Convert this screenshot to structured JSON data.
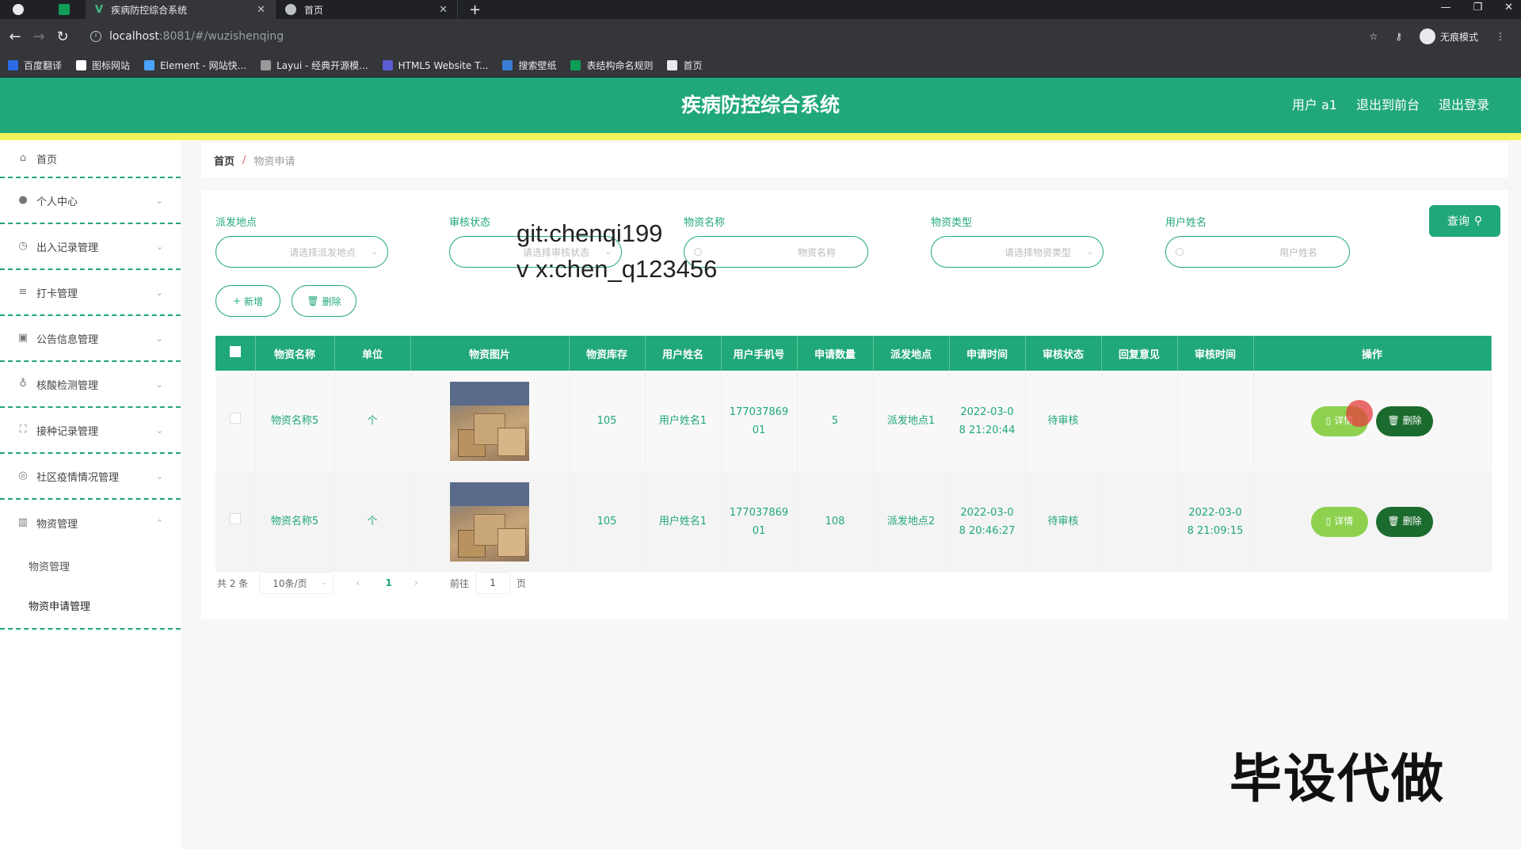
{
  "browser": {
    "tabs": [
      {
        "label": "疾病防控综合系统",
        "active": true
      },
      {
        "label": "首页",
        "active": false
      }
    ],
    "url_host": "localhost",
    "url_path": ":8081/#/wuzishenqing",
    "incognito_label": "无痕模式",
    "bookmarks": [
      {
        "label": "百度翻译",
        "color": "#2d6be4"
      },
      {
        "label": "图标网站",
        "color": "#ffffff"
      },
      {
        "label": "Element - 网站快...",
        "color": "#4aa3ff"
      },
      {
        "label": "Layui - 经典开源模...",
        "color": "#999999"
      },
      {
        "label": "HTML5 Website T...",
        "color": "#5b5bd6"
      },
      {
        "label": "搜索壁纸",
        "color": "#3a7bd5"
      },
      {
        "label": "表结构命名规则",
        "color": "#0f9d58"
      },
      {
        "label": "首页",
        "color": "#e8eaed"
      }
    ]
  },
  "header": {
    "title": "疾病防控综合系统",
    "user": "用户 a1",
    "back_front": "退出到前台",
    "logout": "退出登录"
  },
  "sidebar": {
    "items": [
      {
        "label": "首页",
        "icon": "home-icon"
      },
      {
        "label": "个人中心",
        "icon": "user-icon"
      },
      {
        "label": "出入记录管理",
        "icon": "clock-icon"
      },
      {
        "label": "打卡管理",
        "icon": "list-icon"
      },
      {
        "label": "公告信息管理",
        "icon": "clipboard-icon"
      },
      {
        "label": "核酸检测管理",
        "icon": "mic-icon"
      },
      {
        "label": "接种记录管理",
        "icon": "expand-icon"
      },
      {
        "label": "社区疫情情况管理",
        "icon": "globe-icon"
      },
      {
        "label": "物资管理",
        "icon": "chart-icon"
      }
    ],
    "sub_items": [
      "物资管理",
      "物资申请管理"
    ]
  },
  "breadcrumb": {
    "home": "首页",
    "sep": "/",
    "current": "物资申请"
  },
  "filters": {
    "location": {
      "label": "派发地点",
      "placeholder": "请选择派发地点"
    },
    "status": {
      "label": "审核状态",
      "placeholder": "请选择审核状态"
    },
    "name": {
      "label": "物资名称",
      "placeholder": "物资名称"
    },
    "type": {
      "label": "物资类型",
      "placeholder": "请选择物资类型"
    },
    "user": {
      "label": "用户姓名",
      "placeholder": "用户姓名"
    },
    "search_label": "查询"
  },
  "actions": {
    "add": "新增",
    "delete": "删除"
  },
  "watermark": {
    "line1": "git:chenqi199",
    "line2": "v x:chen_q123456"
  },
  "table": {
    "headers": [
      "物资名称",
      "单位",
      "物资图片",
      "物资库存",
      "用户姓名",
      "用户手机号",
      "申请数量",
      "派发地点",
      "申请时间",
      "审核状态",
      "回复意见",
      "审核时间",
      "操作"
    ],
    "rows": [
      {
        "name": "物资名称5",
        "unit": "个",
        "stock": "105",
        "user": "用户姓名1",
        "phone_a": "177037869",
        "phone_b": "01",
        "qty": "5",
        "location": "派发地点1",
        "time_a": "2022-03-0",
        "time_b": "8 21:20:44",
        "status": "待审核",
        "reply": "",
        "audit_a": "",
        "audit_b": ""
      },
      {
        "name": "物资名称5",
        "unit": "个",
        "stock": "105",
        "user": "用户姓名1",
        "phone_a": "177037869",
        "phone_b": "01",
        "qty": "108",
        "location": "派发地点2",
        "time_a": "2022-03-0",
        "time_b": "8 20:46:27",
        "status": "待审核",
        "reply": "",
        "audit_a": "2022-03-0",
        "audit_b": "8 21:09:15"
      }
    ],
    "detail_label": "详情",
    "delete_label": "删除"
  },
  "pager": {
    "total": "共 2 条",
    "page_size": "10条/页",
    "current": "1",
    "goto": "前往",
    "goto_value": "1",
    "unit": "页"
  },
  "overlay": "毕设代做"
}
